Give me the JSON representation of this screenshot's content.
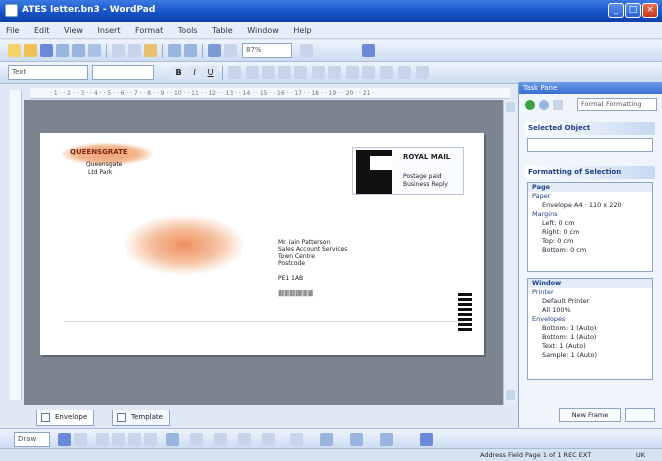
{
  "window": {
    "title": "ATES letter.bn3 - WordPad"
  },
  "menu": [
    "File",
    "Edit",
    "View",
    "Insert",
    "Format",
    "Tools",
    "Table",
    "Window",
    "Help"
  ],
  "toolbar": {
    "zoom": "87%",
    "style_combo": "Text",
    "font_combo": ""
  },
  "ruler": {
    "marks": "· 1 · · 2 · · 3 · · 4 · · 5 · · 6 · · 7 · · 8 · · 9 · · 10 · · 11 · · 12 · · 13 · · 14 · · 15 · · 16 · · 17 · · 18 · · 19 · · 20 · · 21 ·"
  },
  "envelope": {
    "sender_logo": "QUEENSGRATE",
    "sender_lines": [
      "Queensgate",
      "Ltd Park"
    ],
    "postage_label": "ROYAL MAIL",
    "postage_sub": [
      "Postage paid",
      "Business Reply"
    ],
    "recipient": [
      "Mr. Iain Patterson",
      "Sales Account Services",
      "Town Centre",
      "Postcode",
      "PE1 1AB"
    ],
    "barcode_text": "||||| |||| ||||| |||||| |||| |||||"
  },
  "tabs": {
    "tab1": "Envelope",
    "tab2": "Template"
  },
  "drawbar": {
    "draw_label": "Draw"
  },
  "status": {
    "text": "Address Field   Page 1 of 1   REC   EXT",
    "lang": "UK"
  },
  "taskpane": {
    "header": "Task Pane",
    "dropdown": "Format Formatting",
    "selected_object": "Selected Object",
    "formatting_heading": "Formatting of Selection",
    "page_heading": "Page",
    "page_lines": [
      "Paper",
      "Envelope A4 · 110 x 220",
      "Margins",
      "Left: 0 cm",
      "Right: 0 cm",
      "Top: 0 cm",
      "Bottom: 0 cm"
    ],
    "window_heading": "Window",
    "window_lines": [
      "Printer",
      "Default Printer",
      "All 100%",
      "Envelopes",
      "Bottom: 1 (Auto)",
      "Bottom: 1 (Auto)",
      "Text: 1 (Auto)",
      "Sample: 1 (Auto)"
    ],
    "footer_button": "New Frame"
  },
  "colors": {
    "accent": "#1550c8",
    "logo": "#e8703a"
  }
}
